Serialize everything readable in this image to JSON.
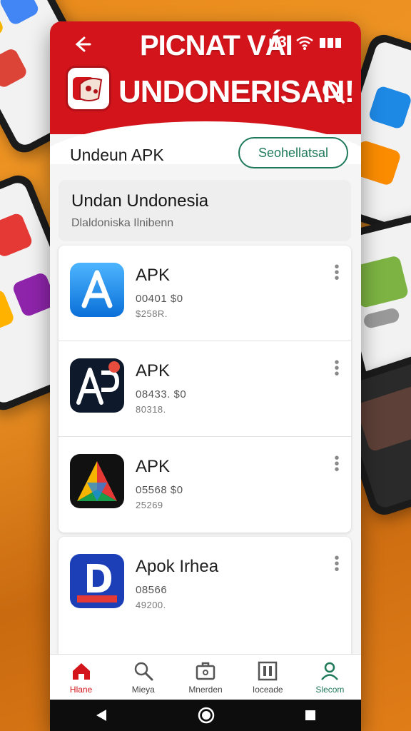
{
  "header": {
    "top_title": "PICNAT VÁI",
    "status_text": "ᴎ3",
    "main_title": "UNDONERISAN!",
    "colors": {
      "brand": "#d3141b",
      "accent": "#1f7a5a"
    }
  },
  "section": {
    "title": "Undeun APK",
    "button_label": "Seohellatsal"
  },
  "banner": {
    "title": "Undan Undonesia",
    "subtitle": "Dlaldoniska Ilnibenn"
  },
  "apps": [
    {
      "name": "APK",
      "meta1": "00401   $0",
      "meta2": "$258R.",
      "icon": "a-blue-icon"
    },
    {
      "name": "APK",
      "meta1": "08433.  $0",
      "meta2": "80318.",
      "icon": "ap-dark-icon"
    },
    {
      "name": "APK",
      "meta1": "05568   $0",
      "meta2": "25269",
      "icon": "triangle-color-icon"
    },
    {
      "name": "Apok Irhea",
      "meta1": "08566",
      "meta2": "49200.",
      "icon": "d-logo-icon"
    }
  ],
  "bottom_nav": [
    {
      "label": "Hlane",
      "icon": "home-icon"
    },
    {
      "label": "Mieya",
      "icon": "search-icon"
    },
    {
      "label": "Mnerden",
      "icon": "briefcase-icon"
    },
    {
      "label": "Ioceade",
      "icon": "columns-icon"
    },
    {
      "label": "Slecom",
      "icon": "person-icon"
    }
  ]
}
